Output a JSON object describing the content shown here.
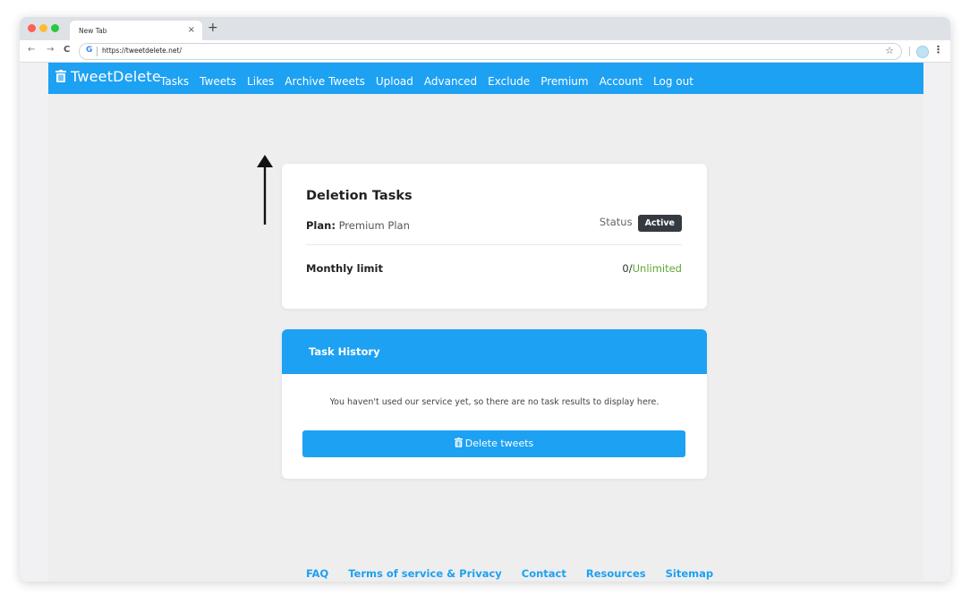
{
  "browser": {
    "tab_title": "New Tab",
    "tab_close": "×",
    "new_tab": "+",
    "url": "https://tweetdelete.net/",
    "back": "←",
    "forward": "→",
    "reload": "C",
    "google_icon": "G",
    "bookmark_icon": "☆",
    "menu_icon": "⋮"
  },
  "site": {
    "logo_text": "TweetDelete",
    "nav": [
      "Tasks",
      "Tweets",
      "Likes",
      "Archive Tweets",
      "Upload",
      "Advanced",
      "Exclude",
      "Premium",
      "Account",
      "Log out"
    ]
  },
  "deletion_tasks": {
    "title": "Deletion Tasks",
    "plan_label": "Plan:",
    "plan_value": "Premium Plan",
    "status_label": "Status",
    "status_badge": "Active",
    "monthly_limit_label": "Monthly limit",
    "monthly_used": "0/",
    "monthly_total": "Unlimited"
  },
  "task_history": {
    "title": "Task History",
    "empty_message": "You haven't used our service yet, so there are no task results to display here.",
    "delete_button": "Delete tweets"
  },
  "footer": {
    "links": [
      "FAQ",
      "Terms of service & Privacy",
      "Contact",
      "Resources",
      "Sitemap"
    ]
  },
  "colors": {
    "brand": "#1da1f2",
    "badge": "#343a40",
    "unlimited": "#5fa833"
  },
  "icons": {
    "logo": "trash-icon",
    "button": "trash-icon",
    "annotation": "arrow-up-icon"
  }
}
